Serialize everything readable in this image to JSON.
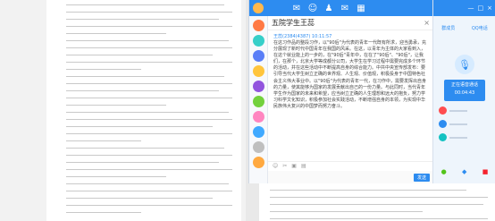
{
  "chat": {
    "title": "五院学生王蕊",
    "close": "×",
    "meta": "王蕊(2384(4387)  10:11:57",
    "message": "在这习作品的整段习作，以\"90后\"为代表的青年一代既有所求，迎当勇承，充分展现了新时代中国青年在我国的风采。在这，以青年为主体的大家看到入，在这个就业能上的一步的，在\"90后\"青年中，在在了\"90后\"、\"90后\"，让我们，在那个，北京大学等成都分公司，大学生在学习过程中需要完成多个环节的活动，并在这些活动中不断提高自身的综合能力。中共中央宣传部发布：要引导当代大学生树立正确的世界观、人生观、价值观，积极投身于中国特色社会主义伟大事业中。以\"90后\"为代表的青年一代，在习作中，需要发挥出自身的力量，使其能够为国家的发展贡献出自己的一份力量。与此同时，当代青年学生作为国家的未来和希望，应当树立正确的人生理想和远大的抱负，努力学习科学文化知识，积极参加社会实践活动，不断增强自身的本领，为实现中华民族伟大复兴的中国梦而努力奋斗。",
    "send": "发送",
    "toolbar_icons": [
      "☺",
      "✂",
      "▣",
      "▤"
    ]
  },
  "side": {
    "tab1": "群成员",
    "tab2": "QQ电话",
    "voice_line1": "正在语音通话",
    "voice_line2": "00:04:43",
    "top_icons": [
      "—",
      "□",
      "×"
    ]
  },
  "icons": [
    "chat-icon",
    "contacts-icon",
    "group-icon",
    "mail-icon",
    "apps-icon"
  ]
}
